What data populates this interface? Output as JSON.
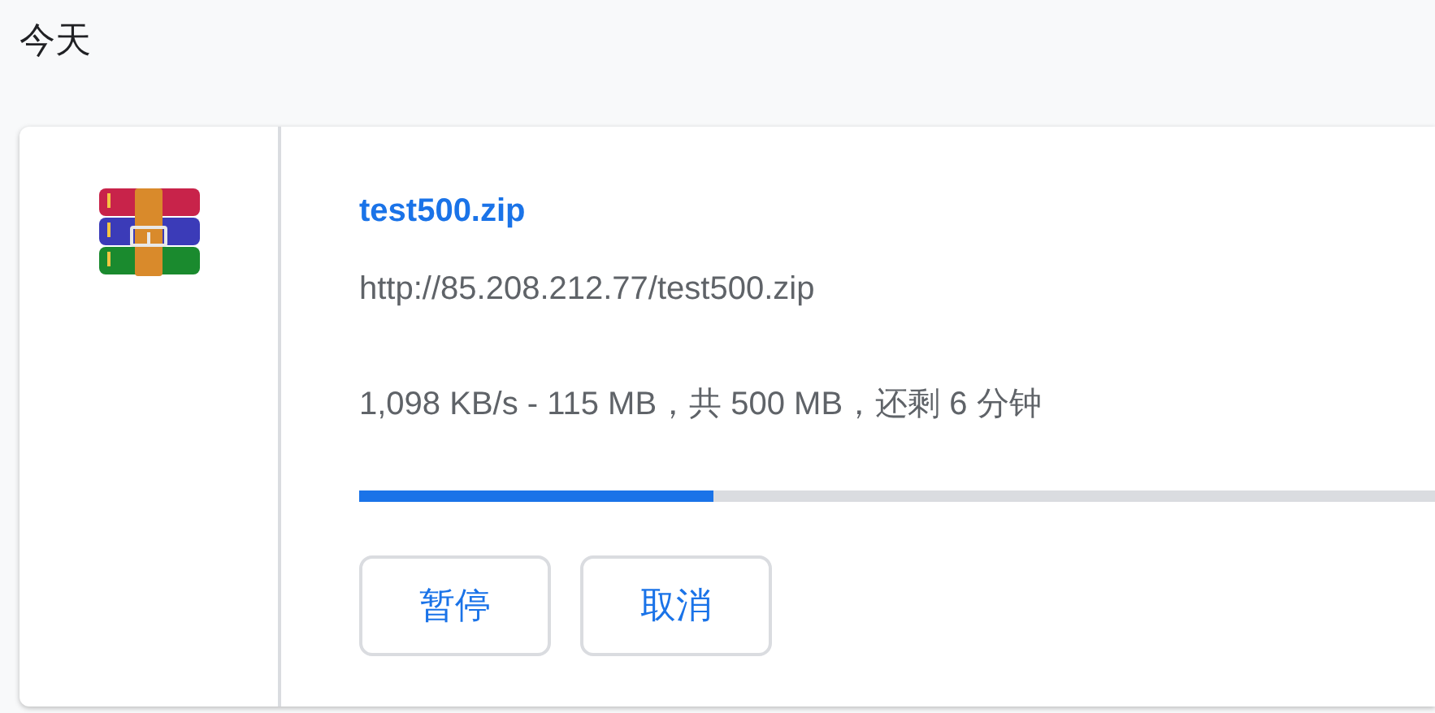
{
  "section_title": "今天",
  "download": {
    "file_name": "test500.zip",
    "url": "http://85.208.212.77/test500.zip",
    "status": "1,098 KB/s - 115 MB，共 500 MB，还剩 6 分钟",
    "level": 0.33,
    "buttons": [
      {
        "label": "暂停"
      },
      {
        "label": "取消"
      }
    ]
  }
}
